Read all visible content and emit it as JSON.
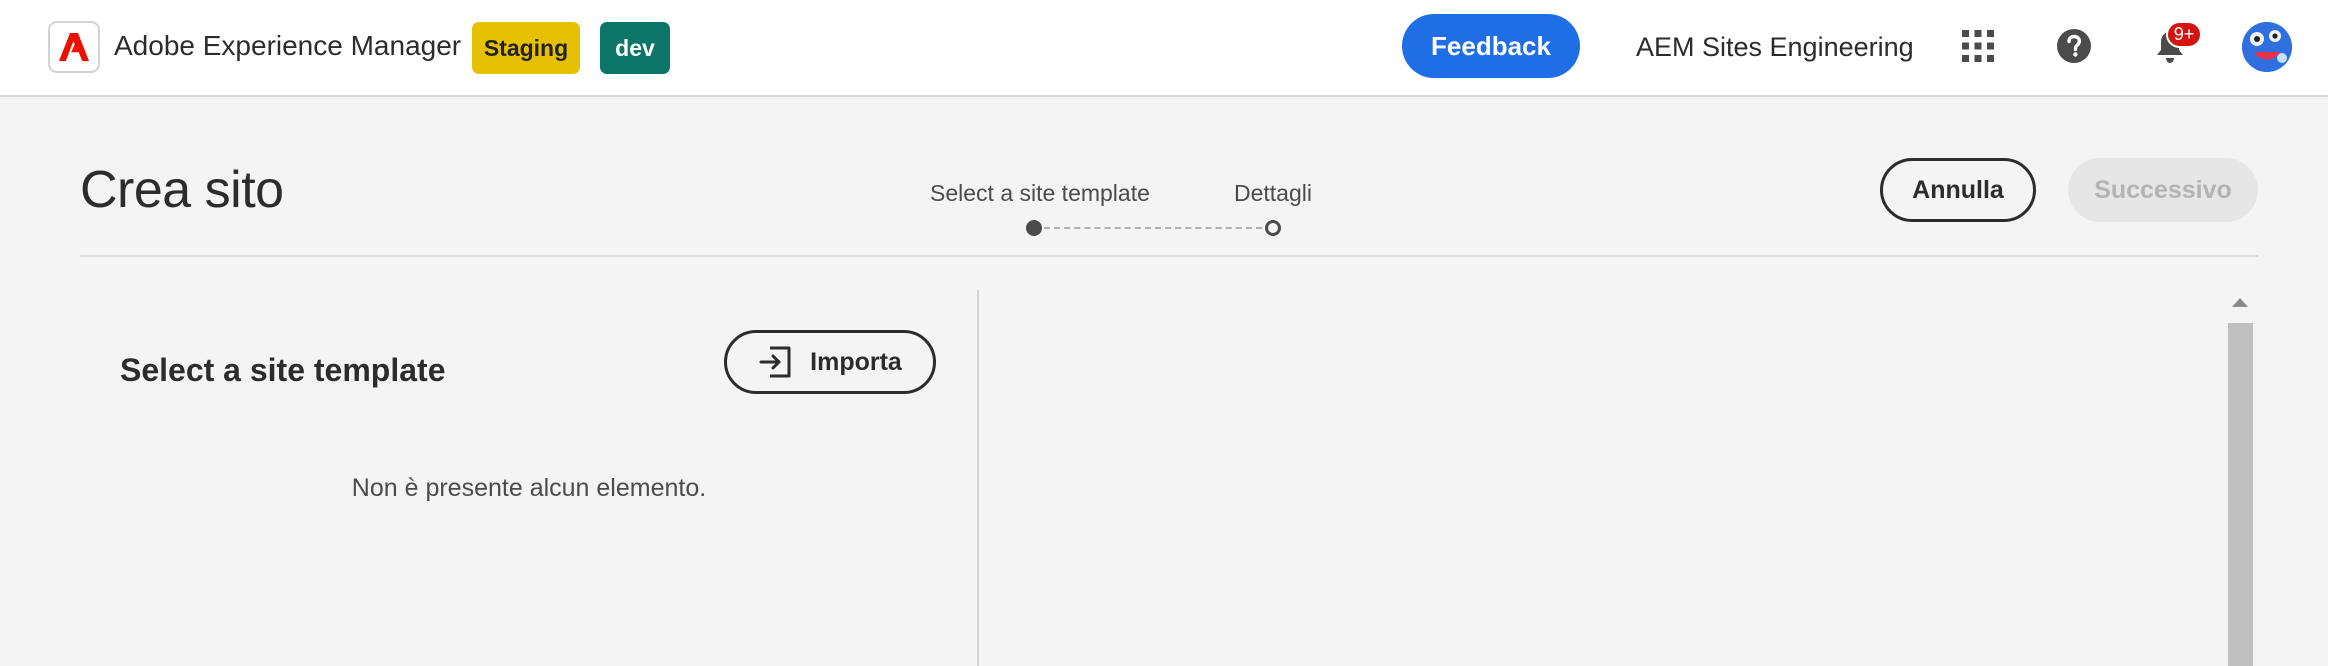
{
  "header": {
    "brand": "Adobe Experience Manager",
    "tags": {
      "staging": "Staging",
      "dev": "dev"
    },
    "feedback_label": "Feedback",
    "org_name": "AEM Sites Engineering",
    "notifications_badge": "9+",
    "icons": [
      "adobe-logo-icon",
      "apps-grid-icon",
      "help-icon",
      "bell-icon",
      "avatar"
    ]
  },
  "wizard": {
    "title": "Crea sito",
    "steps": [
      {
        "label": "Select a site template",
        "state": "current"
      },
      {
        "label": "Dettagli",
        "state": "upcoming"
      }
    ],
    "cancel_label": "Annulla",
    "next_label": "Successivo"
  },
  "left_panel": {
    "title": "Select a site template",
    "import_label": "Importa",
    "empty_message": "Non è presente alcun elemento."
  },
  "colors": {
    "accent": "#1f6ee5",
    "staging_tag": "#e6c102",
    "dev_tag": "#0b7568",
    "badge": "#d31510",
    "adobe_red": "#eb1000"
  }
}
